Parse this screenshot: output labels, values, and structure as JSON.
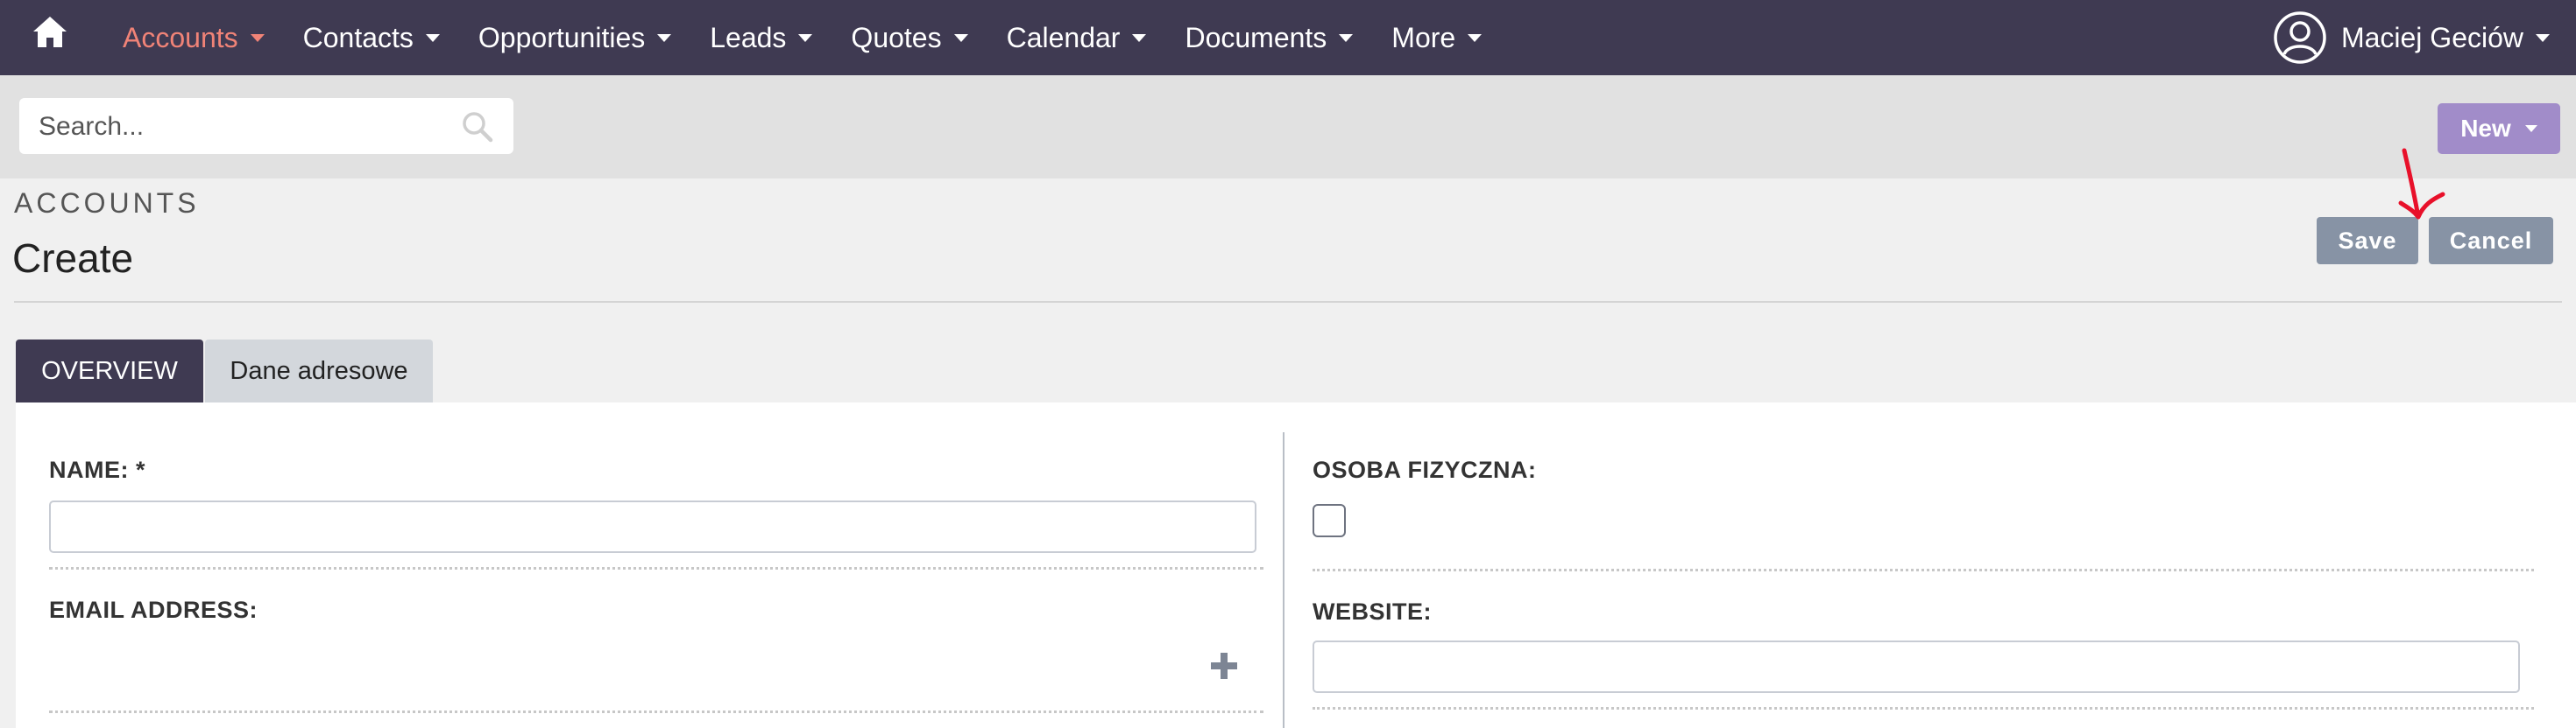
{
  "nav": {
    "items": [
      {
        "label": "Accounts"
      },
      {
        "label": "Contacts"
      },
      {
        "label": "Opportunities"
      },
      {
        "label": "Leads"
      },
      {
        "label": "Quotes"
      },
      {
        "label": "Calendar"
      },
      {
        "label": "Documents"
      },
      {
        "label": "More"
      }
    ],
    "active_index": 0,
    "user_name": "Maciej Geciów"
  },
  "search": {
    "placeholder": "Search..."
  },
  "actions": {
    "new_label": "New",
    "save_label": "Save",
    "cancel_label": "Cancel"
  },
  "header": {
    "module": "ACCOUNTS",
    "title": "Create"
  },
  "tabs": [
    {
      "label": "OVERVIEW",
      "active": true
    },
    {
      "label": "Dane adresowe",
      "active": false
    }
  ],
  "form": {
    "name_label": "NAME: *",
    "name_value": "",
    "email_label": "EMAIL ADDRESS:",
    "osoba_label": "OSOBA FIZYCZNA:",
    "osoba_checked": false,
    "website_label": "WEBSITE:",
    "website_value": ""
  },
  "colors": {
    "navbar": "#3f3a52",
    "accent_active": "#f08377",
    "new_button": "#a18cc9",
    "gray_button": "#8793a5",
    "annotation": "#e8102a"
  }
}
